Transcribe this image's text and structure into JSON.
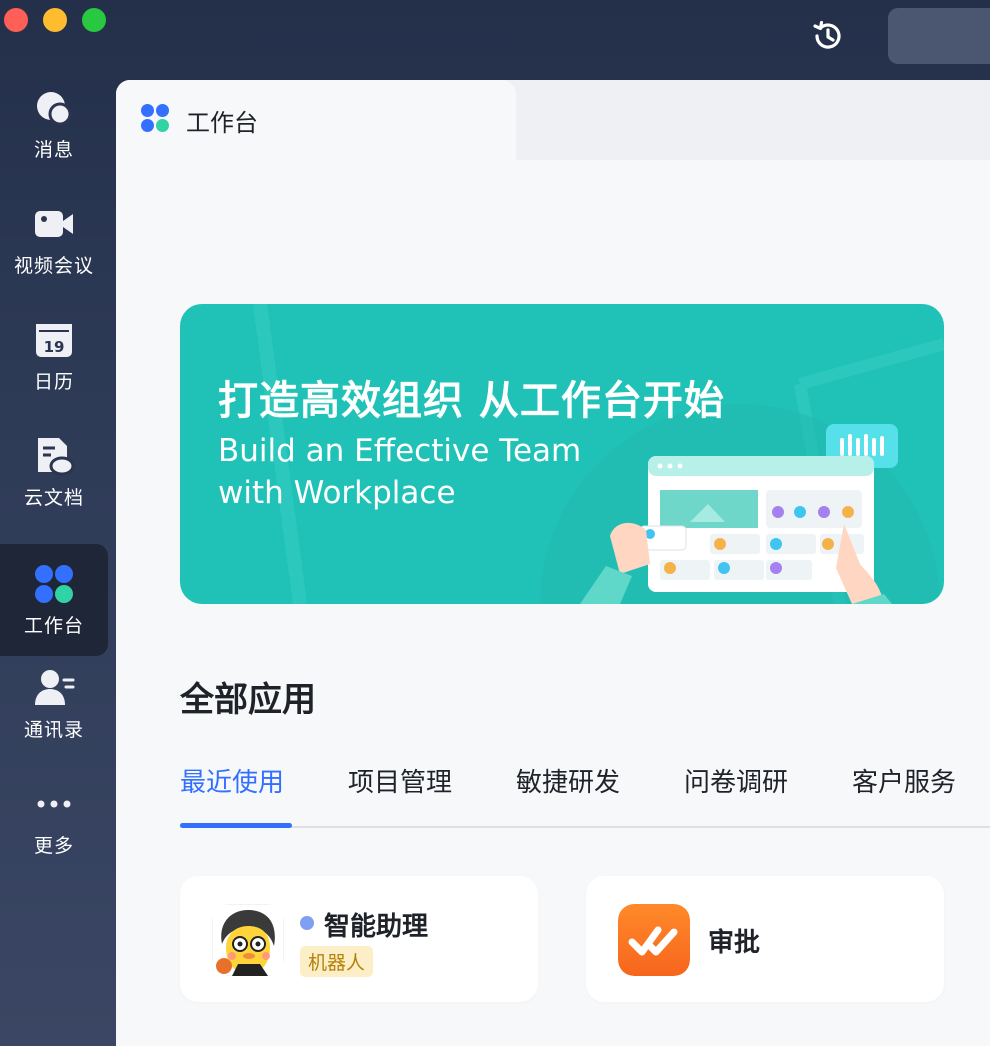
{
  "titlebar": {
    "buttons": [
      "close",
      "minimize",
      "maximize"
    ],
    "history_icon": "history-icon"
  },
  "sidebar": {
    "items": [
      {
        "label": "消息",
        "icon": "chat-bubble-icon"
      },
      {
        "label": "视频会议",
        "icon": "video-camera-icon"
      },
      {
        "label": "日历",
        "icon": "calendar-icon",
        "day": "19"
      },
      {
        "label": "云文档",
        "icon": "cloud-doc-icon"
      },
      {
        "label": "工作台",
        "icon": "workplace-icon",
        "active": true
      },
      {
        "label": "通讯录",
        "icon": "contacts-icon"
      },
      {
        "label": "更多",
        "icon": "more-icon"
      }
    ]
  },
  "tab": {
    "title": "工作台",
    "icon": "workplace-icon"
  },
  "banner": {
    "title": "打造高效组织 从工作台开始",
    "subtitle_line1": "Build an Effective Team",
    "subtitle_line2": "with Workplace",
    "bg_color": "#20c2b8"
  },
  "section": {
    "title": "全部应用"
  },
  "categories": [
    {
      "label": "最近使用",
      "active": true
    },
    {
      "label": "项目管理"
    },
    {
      "label": "敏捷研发"
    },
    {
      "label": "问卷调研"
    },
    {
      "label": "客户服务"
    }
  ],
  "apps": [
    {
      "name": "智能助理",
      "badge": "机器人",
      "icon": "assistant-avatar-icon"
    },
    {
      "name": "审批",
      "icon": "approval-icon"
    }
  ],
  "colors": {
    "accent": "#3370ff",
    "sidebar": "#2b3550",
    "banner": "#20c2b8"
  }
}
